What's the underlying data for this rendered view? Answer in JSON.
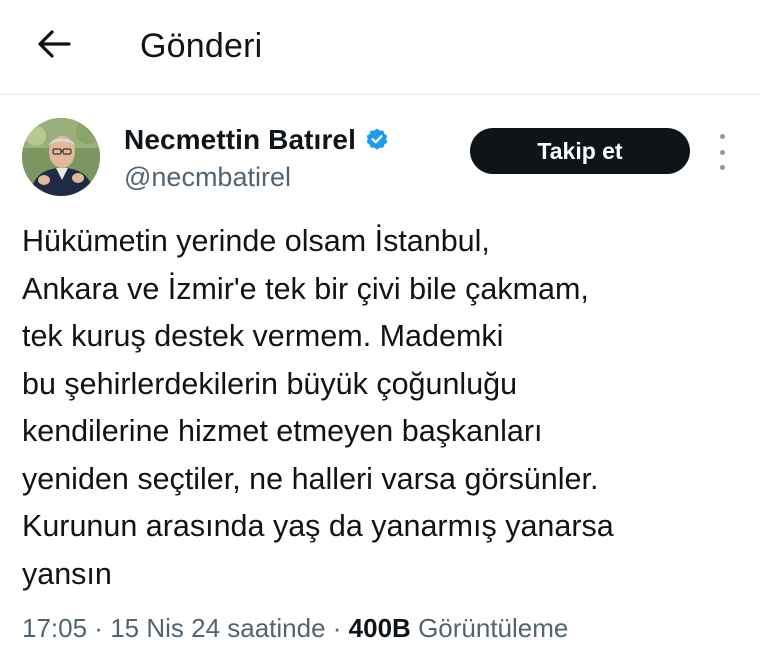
{
  "header": {
    "title": "Gönderi",
    "back_icon": "arrow-left-icon"
  },
  "author": {
    "display_name": "Necmettin Batırel",
    "handle": "@necmbatirel",
    "verified": true,
    "verified_color": "#1d9bf0"
  },
  "actions": {
    "follow_label": "Takip et",
    "more_icon": "more-vertical-icon"
  },
  "tweet": {
    "lines": [
      "Hükümetin yerinde olsam İstanbul,",
      "Ankara ve İzmir'e tek bir çivi bile çakmam,",
      "tek kuruş destek vermem. Mademki",
      "bu şehirlerdekilerin büyük çoğunluğu",
      "kendilerine hizmet etmeyen başkanları",
      "yeniden seçtiler, ne halleri varsa görsünler.",
      "Kurunun arasında yaş da yanarmış yanarsa",
      "yansın"
    ]
  },
  "meta": {
    "time": "17:05",
    "separator": " · ",
    "date": "15 Nis 24 saatinde",
    "views_count": "400B",
    "views_label": "Görüntüleme"
  }
}
